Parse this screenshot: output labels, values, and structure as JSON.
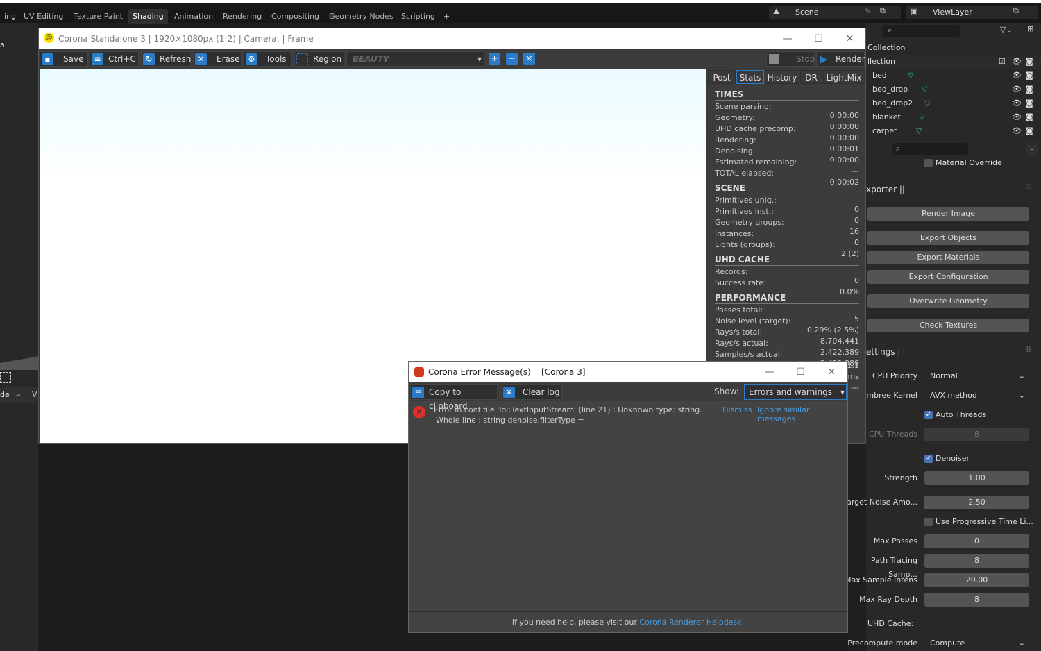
{
  "blender": {
    "workspaces": [
      "ing",
      "UV Editing",
      "Texture Paint",
      "Shading",
      "Animation",
      "Rendering",
      "Compositing",
      "Geometry Nodes",
      "Scripting",
      "+"
    ],
    "active_workspace": "Shading",
    "scene": "Scene",
    "view_layer": "ViewLayer",
    "outliner": {
      "collection": "Collection",
      "sub_collection": "llection",
      "objects": [
        "bed",
        "bed_drop",
        "bed_drop2",
        "blanket",
        "carpet"
      ]
    },
    "left_mode": "de",
    "left_v": "V",
    "left_a": "a",
    "material_override": "Material Override",
    "exporter_header": "xporter ||",
    "exporter_buttons": [
      "Render Image",
      "Export Objects",
      "Export Materials",
      "Export Configuration",
      "Overwrite Geometry",
      "Check Textures"
    ],
    "settings_header": "ettings ||",
    "cpu_priority": {
      "label": "CPU Priority",
      "value": "Normal"
    },
    "embree": {
      "label": "Embree Kernel",
      "value": "AVX method"
    },
    "auto_threads": {
      "label": "Auto Threads",
      "checked": true
    },
    "cpu_threads": {
      "label": "CPU Threads",
      "value": "8"
    },
    "denoiser": {
      "label": "Denoiser",
      "checked": true
    },
    "strength": {
      "label": "Strength",
      "value": "1.00"
    },
    "target_noise": {
      "label": "Target Noise Amo...",
      "value": "2.50"
    },
    "progressive": {
      "label": "Use Progressive Time Li...",
      "checked": false
    },
    "max_passes": {
      "label": "Max Passes",
      "value": "0"
    },
    "pt_samples": {
      "label": "Path Tracing Samp...",
      "value": "8"
    },
    "max_sample": {
      "label": "Max Sample Intens",
      "value": "20.00"
    },
    "max_depth": {
      "label": "Max Ray Depth",
      "value": "8"
    },
    "uhd_cache": "UHD Cache:",
    "precompute": {
      "label": "Precompute mode",
      "value": "Compute"
    }
  },
  "corona": {
    "title": "Corona Standalone 3 | 1920×1080px (1:2) | Camera:  | Frame",
    "toolbar": {
      "save": "Save",
      "copy": "Ctrl+C",
      "refresh": "Refresh",
      "erase": "Erase",
      "tools": "Tools",
      "region": "Region",
      "pass": "BEAUTY",
      "stop": "Stop",
      "render": "Render"
    },
    "tabs": [
      "Post",
      "Stats",
      "History",
      "DR",
      "LightMix"
    ],
    "active_tab": "Stats",
    "stats": [
      {
        "header": "TIMES",
        "rows": [
          [
            "Scene parsing:",
            "0:00:00"
          ],
          [
            "Geometry:",
            "0:00:00"
          ],
          [
            "UHD cache precomp:",
            "0:00:00"
          ],
          [
            "Rendering:",
            "0:00:01"
          ],
          [
            "Denoising:",
            "0:00:00"
          ],
          [
            "Estimated remaining:",
            "---"
          ],
          [
            "TOTAL elapsed:",
            "0:00:02"
          ]
        ]
      },
      {
        "header": "SCENE",
        "rows": [
          [
            "Primitives uniq.:",
            "0"
          ],
          [
            "Primitives inst.:",
            "0"
          ],
          [
            "Geometry groups:",
            "16"
          ],
          [
            "Instances:",
            "0"
          ],
          [
            "Lights (groups):",
            "2 (2)"
          ]
        ]
      },
      {
        "header": "UHD CACHE",
        "rows": [
          [
            "Records:",
            "0"
          ],
          [
            "Success rate:",
            "0.0%"
          ]
        ]
      },
      {
        "header": "PERFORMANCE",
        "rows": [
          [
            "Passes total:",
            "5"
          ],
          [
            "Noise level (target):",
            "0.29% (2.5%)"
          ],
          [
            "Rays/s total:",
            "8,704,441"
          ],
          [
            "Rays/s actual:",
            "2,422,389"
          ],
          [
            "Samples/s actual:",
            "2,422,389"
          ],
          [
            "",
            "1.1"
          ],
          [
            "",
            "ms"
          ],
          [
            "",
            "---"
          ]
        ]
      }
    ]
  },
  "error_dialog": {
    "title": "Corona Error Message(s)    [Corona 3]",
    "copy": "Copy to clipboard",
    "clear": "Clear log",
    "show_label": "Show:",
    "show_value": "Errors and warnings",
    "message_line1": "Error in.conf file 'Io::TextInputStream' (line 21) : Unknown type: string.",
    "message_line2": "Whole line : string denoise.filterType =",
    "dismiss": "Dismiss",
    "ignore": "Ignore similar messages",
    "footer_text": "If you need help, please visit our ",
    "footer_link": "Corona Renderer Helpdesk."
  },
  "colors": {
    "accent": "#2a7bc8",
    "blender_check": "#4772b3",
    "mesh_icon": "#2fbf8a",
    "error": "#e0302c"
  }
}
